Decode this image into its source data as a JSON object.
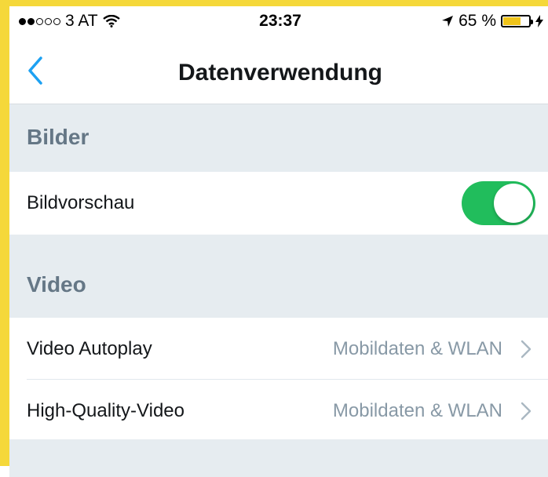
{
  "status_bar": {
    "carrier": "3 AT",
    "time": "23:37",
    "battery_percent": "65 %",
    "signal_strength": 2,
    "battery_level": 0.65
  },
  "nav": {
    "title": "Datenverwendung",
    "back_icon": "chevron-left-icon"
  },
  "sections": {
    "images": {
      "title": "Bilder",
      "preview_label": "Bildvorschau",
      "preview_enabled": true
    },
    "video": {
      "title": "Video",
      "autoplay_label": "Video Autoplay",
      "autoplay_value": "Mobildaten & WLAN",
      "hq_label": "High-Quality-Video",
      "hq_value": "Mobildaten & WLAN"
    }
  },
  "colors": {
    "accent": "#1da1f2",
    "toggle_on": "#21bd5c",
    "section_bg": "#e6ecf0",
    "frame": "#f5d83a"
  }
}
